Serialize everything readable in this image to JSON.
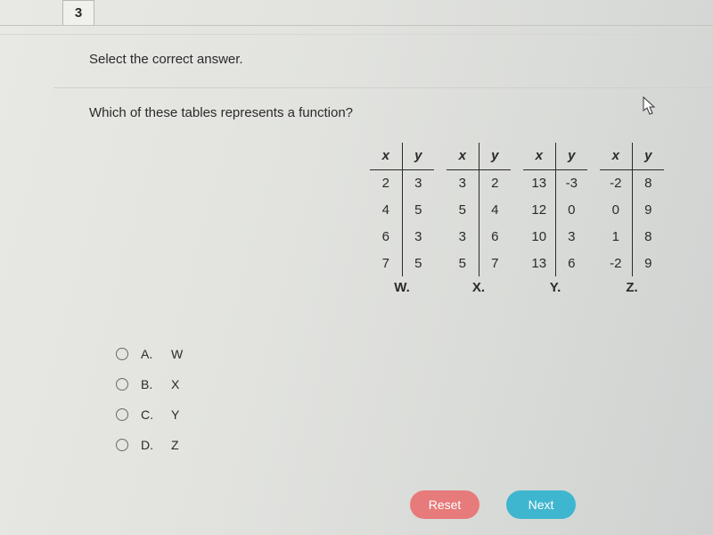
{
  "tab_number": "3",
  "instruction": "Select the correct answer.",
  "question": "Which of these tables represents a function?",
  "header_x": "x",
  "header_y": "y",
  "tables": [
    {
      "label": "W.",
      "rows": [
        [
          "2",
          "3"
        ],
        [
          "4",
          "5"
        ],
        [
          "6",
          "3"
        ],
        [
          "7",
          "5"
        ]
      ]
    },
    {
      "label": "X.",
      "rows": [
        [
          "3",
          "2"
        ],
        [
          "5",
          "4"
        ],
        [
          "3",
          "6"
        ],
        [
          "5",
          "7"
        ]
      ]
    },
    {
      "label": "Y.",
      "rows": [
        [
          "13",
          "-3"
        ],
        [
          "12",
          "0"
        ],
        [
          "10",
          "3"
        ],
        [
          "13",
          "6"
        ]
      ]
    },
    {
      "label": "Z.",
      "rows": [
        [
          "-2",
          "8"
        ],
        [
          "0",
          "9"
        ],
        [
          "1",
          "8"
        ],
        [
          "-2",
          "9"
        ]
      ]
    }
  ],
  "options": [
    {
      "letter": "A.",
      "value": "W"
    },
    {
      "letter": "B.",
      "value": "X"
    },
    {
      "letter": "C.",
      "value": "Y"
    },
    {
      "letter": "D.",
      "value": "Z"
    }
  ],
  "buttons": {
    "reset": "Reset",
    "next": "Next"
  }
}
